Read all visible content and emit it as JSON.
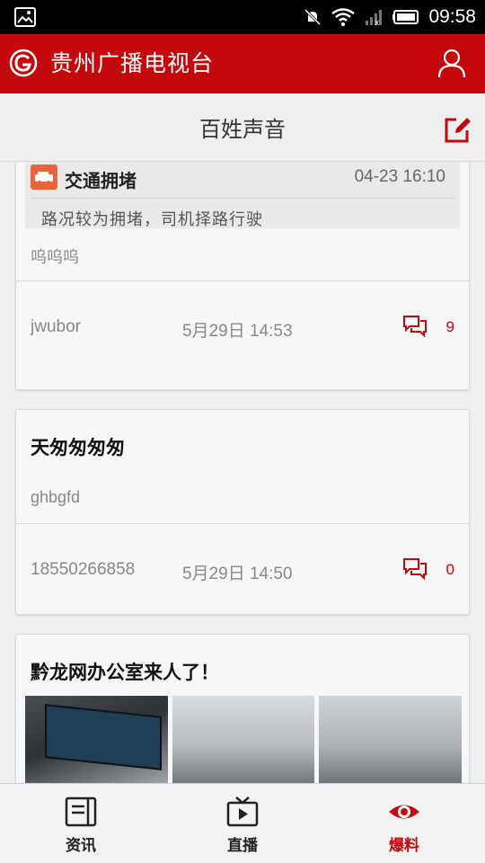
{
  "status_bar": {
    "time": "09:58"
  },
  "app_bar": {
    "title": "贵州广播电视台",
    "logo_icon": "broadcast-logo-icon",
    "user_icon": "user-icon"
  },
  "sub_header": {
    "title": "百姓声音",
    "edit_icon": "edit-icon"
  },
  "colors": {
    "brand_red": "#c4080b",
    "accent_orange": "#e8643b"
  },
  "posts": [
    {
      "quote": {
        "title": "交通拥堵",
        "time": "04-23 16:10",
        "text": "路况较为拥堵，司机择路行驶"
      },
      "body": "呜呜呜",
      "author": "jwubor",
      "date": "5月29日 14:53",
      "comments": "9"
    },
    {
      "title": "天匆匆匆匆",
      "body": "ghbgfd",
      "author": "18550266858",
      "date": "5月29日 14:50",
      "comments": "0"
    },
    {
      "title": "黔龙网办公室来人了！"
    }
  ],
  "tabs": [
    {
      "label": "资讯",
      "icon": "news-icon",
      "active": false
    },
    {
      "label": "直播",
      "icon": "tv-icon",
      "active": false
    },
    {
      "label": "爆料",
      "icon": "eye-icon",
      "active": true
    }
  ]
}
